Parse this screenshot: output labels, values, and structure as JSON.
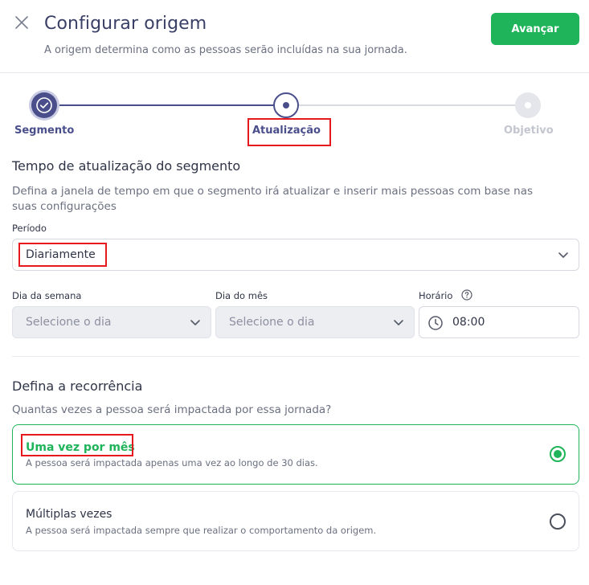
{
  "header": {
    "title": "Configurar origem",
    "subtitle": "A origem determina como as pessoas serão incluídas na sua jornada.",
    "next_button": "Avançar",
    "close_icon": "close-icon"
  },
  "stepper": {
    "steps": [
      {
        "label": "Segmento",
        "state": "completed"
      },
      {
        "label": "Atualização",
        "state": "current"
      },
      {
        "label": "Objetivo",
        "state": "upcoming"
      }
    ]
  },
  "update_section": {
    "title": "Tempo de atualização do segmento",
    "description_line1": "Defina a janela de tempo em que o segmento irá atualizar e inserir mais pessoas com base nas",
    "description_line2": "suas configurações",
    "period": {
      "label": "Período",
      "value": "Diariamente"
    },
    "weekday": {
      "label": "Dia da semana",
      "placeholder": "Selecione o dia",
      "disabled": true
    },
    "monthday": {
      "label": "Dia do mês",
      "placeholder": "Selecione o dia",
      "disabled": true
    },
    "time": {
      "label": "Horário",
      "value": "08:00"
    }
  },
  "recurrence_section": {
    "title": "Defina a recorrência",
    "question": "Quantas vezes a pessoa será impactada por essa jornada?",
    "options": [
      {
        "title": "Uma vez por mês",
        "description": "A pessoa será impactada apenas uma vez ao longo de 30 dias.",
        "selected": true
      },
      {
        "title": "Múltiplas vezes",
        "description": "A pessoa será impactada sempre que realizar o comportamento da origem.",
        "selected": false
      }
    ]
  },
  "colors": {
    "primary_green": "#1fb45a",
    "stepper_navy": "#4a4f8c",
    "highlight_red": "#e8191e"
  }
}
